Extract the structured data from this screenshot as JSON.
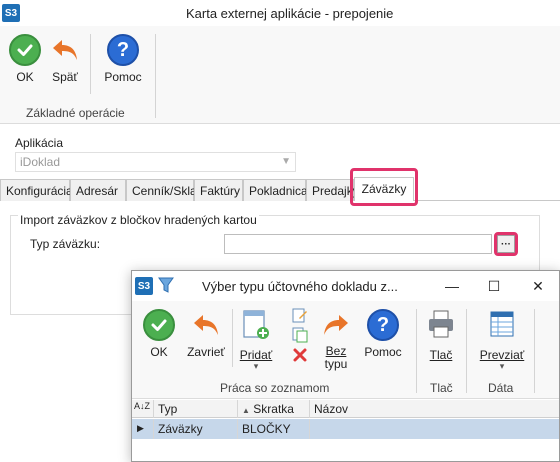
{
  "main_window": {
    "app_badge": "S3",
    "title": "Karta externej aplikácie - prepojenie",
    "ribbon": {
      "buttons": [
        {
          "label": "OK",
          "icon": "check-circle-icon"
        },
        {
          "label": "Späť",
          "icon": "undo-arrow-icon"
        },
        {
          "label": "Pomoc",
          "icon": "help-icon"
        }
      ],
      "group_label": "Základné operácie"
    },
    "application_label": "Aplikácia",
    "application_value": "iDoklad",
    "tabs": [
      "Konfigurácia",
      "Adresár",
      "Cenník/Sklad",
      "Faktúry",
      "Pokladnica",
      "Predajky",
      "Záväzky"
    ],
    "active_tab": "Záväzky",
    "section_title": "Import záväzkov z bločkov hradených kartou",
    "field_label": "Typ záväzku:",
    "field_value": "",
    "ellipsis_label": "···"
  },
  "dialog": {
    "app_badge": "S3",
    "title": "Výber typu účtovného dokladu z...",
    "window_controls": {
      "minimize": "—",
      "maximize": "☐",
      "close": "✕"
    },
    "ribbon": {
      "buttons": [
        {
          "label": "OK",
          "icon": "check-circle-icon"
        },
        {
          "label": "Zavrieť",
          "icon": "undo-arrow-icon"
        },
        {
          "label": "Pridať",
          "icon": "add-document-icon"
        },
        {
          "label": "Bez typu",
          "icon": "forward-arrow-icon"
        },
        {
          "label": "Pomoc",
          "icon": "help-icon"
        },
        {
          "label": "Tlač",
          "icon": "printer-icon"
        },
        {
          "label": "Prevziať",
          "icon": "data-table-icon"
        }
      ],
      "bez_line1": "Bez",
      "bez_line2": "typu",
      "group_labels": [
        "Práca so zoznamom",
        "Tlač",
        "Dáta"
      ]
    },
    "grid": {
      "columns": [
        "Typ",
        "Skratka",
        "Názov"
      ],
      "rows": [
        {
          "typ": "Záväzky",
          "skratka": "BLOČKY",
          "nazov": ""
        }
      ]
    }
  },
  "colors": {
    "highlight": "#e0336b",
    "brand_badge": "#1f6fb5",
    "ok_green": "#4caf50",
    "help_blue": "#2b6cd4",
    "undo_orange": "#e8752a",
    "selected_row": "#c6d7ea"
  }
}
